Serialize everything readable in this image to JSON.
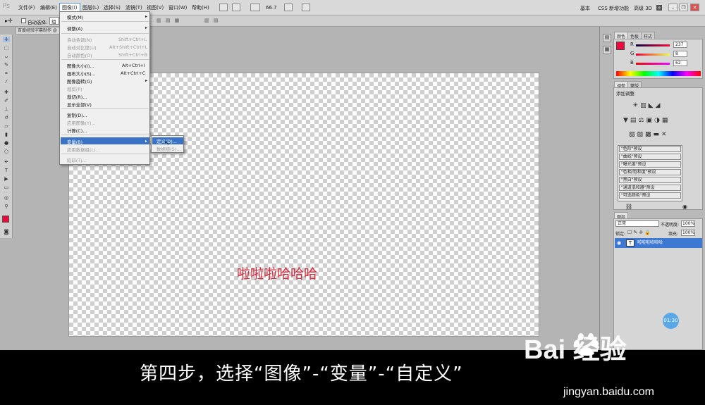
{
  "menubar": {
    "logo": "Ps",
    "items": [
      "文件(F)",
      "编辑(E)",
      "图像(I)",
      "图层(L)",
      "选择(S)",
      "滤镜(T)",
      "视图(V)",
      "窗口(W)",
      "帮助(H)"
    ],
    "zoom": "66.7",
    "workspaces": [
      "基本",
      "CSS 新增功能",
      "高级 3D"
    ],
    "more": "»"
  },
  "options": {
    "auto_select_label": "自动选择:",
    "auto_select_value": "组"
  },
  "doc_tab": "百度经验字幕制作 @",
  "image_menu": {
    "items": [
      {
        "label": "模式(M)",
        "shortcut": "",
        "disabled": false,
        "submenu": true
      },
      {
        "label": "调整(A)",
        "shortcut": "",
        "disabled": false,
        "submenu": true
      },
      {
        "label": "自动色调(N)",
        "shortcut": "Shift+Ctrl+L",
        "disabled": true,
        "submenu": false
      },
      {
        "label": "自动对比度(U)",
        "shortcut": "Alt+Shift+Ctrl+L",
        "disabled": true,
        "submenu": false
      },
      {
        "label": "自动颜色(O)",
        "shortcut": "Shift+Ctrl+B",
        "disabled": true,
        "submenu": false
      },
      {
        "label": "图像大小(I)...",
        "shortcut": "Alt+Ctrl+I",
        "disabled": false,
        "submenu": false
      },
      {
        "label": "画布大小(S)...",
        "shortcut": "Alt+Ctrl+C",
        "disabled": false,
        "submenu": false
      },
      {
        "label": "图像旋转(G)",
        "shortcut": "",
        "disabled": false,
        "submenu": true
      },
      {
        "label": "裁剪(P)",
        "shortcut": "",
        "disabled": true,
        "submenu": false
      },
      {
        "label": "裁切(R)...",
        "shortcut": "",
        "disabled": false,
        "submenu": false
      },
      {
        "label": "显示全部(V)",
        "shortcut": "",
        "disabled": false,
        "submenu": false
      },
      {
        "label": "复制(D)...",
        "shortcut": "",
        "disabled": false,
        "submenu": false
      },
      {
        "label": "应用图像(Y)...",
        "shortcut": "",
        "disabled": true,
        "submenu": false
      },
      {
        "label": "计算(C)...",
        "shortcut": "",
        "disabled": false,
        "submenu": false
      },
      {
        "label": "变量(B)",
        "shortcut": "",
        "disabled": false,
        "submenu": true
      },
      {
        "label": "应用数据组(L)...",
        "shortcut": "",
        "disabled": true,
        "submenu": false
      },
      {
        "label": "陷印(T)...",
        "shortcut": "",
        "disabled": true,
        "submenu": false
      }
    ],
    "variables_submenu": [
      "定义(D)...",
      "数据组(S)..."
    ]
  },
  "canvas_text": "啦啦啦哈哈哈",
  "color_panel": {
    "tabs": [
      "颜色",
      "色板",
      "样式"
    ],
    "channels": [
      {
        "label": "R",
        "value": "237"
      },
      {
        "label": "G",
        "value": "8"
      },
      {
        "label": "B",
        "value": "62"
      }
    ],
    "foreground_color": "#ED083E"
  },
  "adjustments_panel": {
    "tabs": [
      "调整",
      "蒙版"
    ],
    "title": "添加调整",
    "presets": [
      "\"色阶\"预设",
      "\"曲线\"预设",
      "\"曝光度\"预设",
      "\"色相/饱和度\"预设",
      "\"黑白\"预设",
      "\"通道混和器\"预设",
      "\"可选颜色\"预设"
    ]
  },
  "layers_panel": {
    "tabs": [
      "图层"
    ],
    "blend_mode": "正常",
    "opacity_label": "不透明度:",
    "opacity": "100%",
    "lock_label": "锁定:",
    "fill_label": "填充:",
    "fill": "100%",
    "layer_name": "啦啦啦哈哈哈"
  },
  "timer": "01:30",
  "caption": "第四步，选择“图像”-“变量”-“自定义”",
  "watermark": {
    "logo": "Bai 经验",
    "url": "jingyan.baidu.com"
  }
}
